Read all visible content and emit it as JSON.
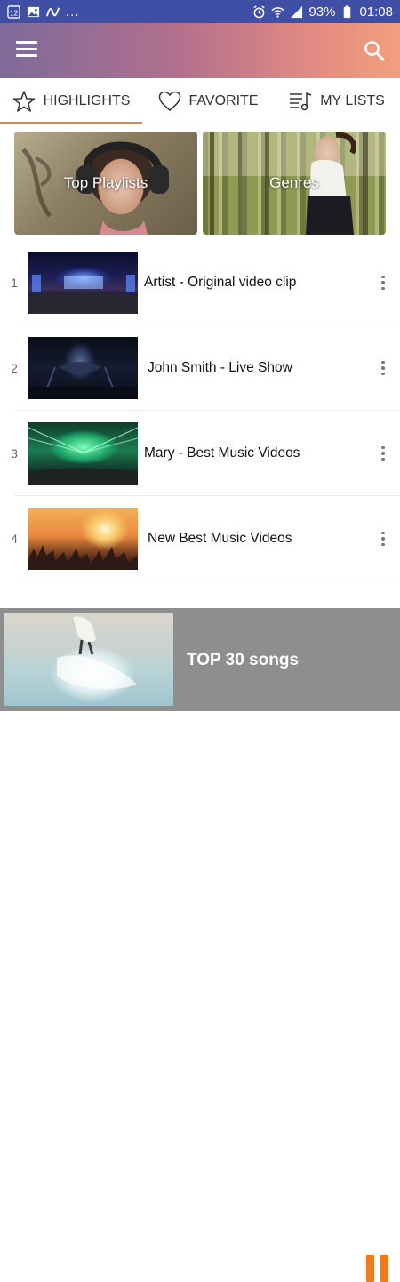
{
  "status_bar": {
    "battery": "93%",
    "time": "01:08",
    "overflow": "..."
  },
  "app_bar": {
    "menu_icon": "hamburger-menu-icon",
    "search_icon": "search-icon"
  },
  "tabs": [
    {
      "label": "HIGHLIGHTS",
      "icon": "star-icon",
      "active": true
    },
    {
      "label": "FAVORITE",
      "icon": "heart-icon",
      "active": false
    },
    {
      "label": "MY LISTS",
      "icon": "playlist-icon",
      "active": false
    }
  ],
  "categories": [
    {
      "label": "Top Playlists"
    },
    {
      "label": "Genres"
    }
  ],
  "videos": [
    {
      "number": "1",
      "title": "Artist - Original video clip"
    },
    {
      "number": "2",
      "title": "John Smith - Live Show"
    },
    {
      "number": "3",
      "title": "Mary - Best Music Videos"
    },
    {
      "number": "4",
      "title": "New Best Music Videos"
    }
  ],
  "player": {
    "track_title": "TOP 30 songs",
    "state": "playing"
  },
  "colors": {
    "status_bar": "#3f4fa6",
    "accent": "#e8823c",
    "pause": "#f07a1c"
  }
}
